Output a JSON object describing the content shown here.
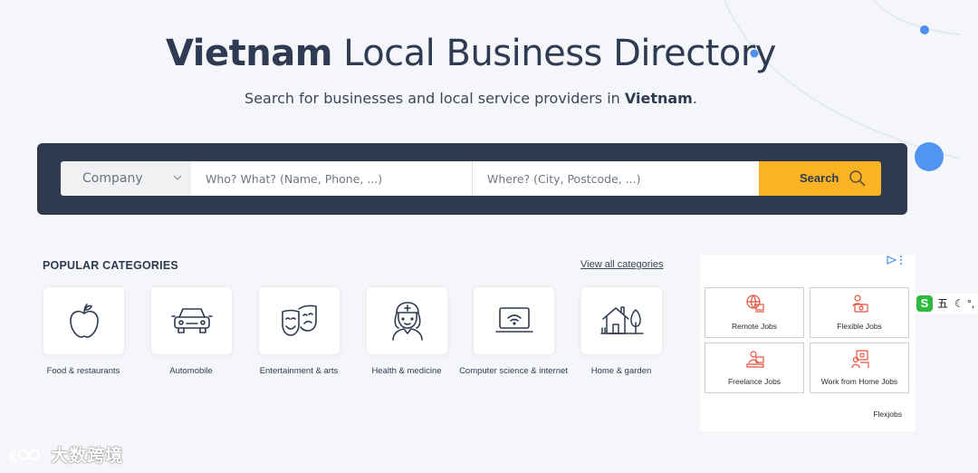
{
  "header": {
    "title_bold": "Vietnam",
    "title_rest": " Local Business Directory",
    "subtitle_pre": "Search for businesses and local service providers in ",
    "subtitle_bold": "Vietnam",
    "subtitle_post": "."
  },
  "search": {
    "type_select": "Company",
    "what_placeholder": "Who? What? (Name, Phone, ...)",
    "where_placeholder": "Where? (City, Postcode, ...)",
    "button_label": "Search"
  },
  "categories": {
    "heading": "POPULAR CATEGORIES",
    "view_all": "View all categories",
    "items": [
      {
        "label": "Food & restaurants",
        "icon": "apple-icon"
      },
      {
        "label": "Automobile",
        "icon": "car-icon"
      },
      {
        "label": "Entertainment & arts",
        "icon": "theater-masks-icon"
      },
      {
        "label": "Health & medicine",
        "icon": "nurse-icon"
      },
      {
        "label": "Computer science & internet",
        "icon": "laptop-wifi-icon"
      },
      {
        "label": "Home & garden",
        "icon": "house-tree-icon"
      }
    ]
  },
  "ad": {
    "tiles": [
      "Remote Jobs",
      "Flexible Jobs",
      "Freelance Jobs",
      "Work from Home Jobs"
    ],
    "brand": "Flexjobs"
  },
  "ime": {
    "label": "五",
    "extra": "°,"
  },
  "watermark": "大数跨境",
  "colors": {
    "accent": "#fbb323",
    "bar": "#2f3a4f",
    "deco_blue": "#4f8ff0",
    "ad_icon": "#e8523c"
  }
}
